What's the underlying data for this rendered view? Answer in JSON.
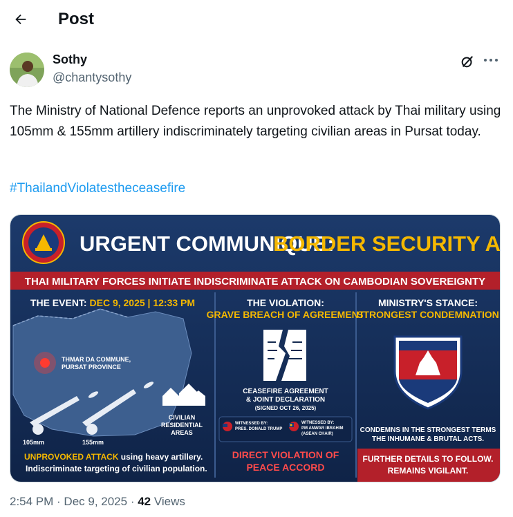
{
  "header": {
    "title": "Post"
  },
  "author": {
    "name": "Sothy",
    "handle": "@chantysothy"
  },
  "post": {
    "text": "The Ministry of National Defence reports an unprovoked attack by Thai military using 105mm & 155mm artillery indiscriminately targeting civilian areas in Pursat today.",
    "hashtag": "#ThailandViolatestheceasefire"
  },
  "media": {
    "headline_a": "URGENT COMMUNIQUE:",
    "headline_b": "BORDER SECURITY ALERT",
    "banner": "THAI MILITARY FORCES INITIATE INDISCRIMINATE ATTACK ON CAMBODIAN SOVEREIGNTY",
    "seal_text": "MINISTRY OF NATIONAL DEFENCE",
    "col1": {
      "heading_a": "THE EVENT:",
      "heading_b": "DEC 9, 2025 | 12:33 PM",
      "location_a": "THMAR DA COMMUNE,",
      "location_b": "PURSAT PROVINCE",
      "civ_a": "CIVILIAN",
      "civ_b": "RESIDENTIAL",
      "civ_c": "AREAS",
      "gun1": "105mm",
      "gun2": "155mm",
      "foot_a_red": "UNPROVOKED ATTACK",
      "foot_a_rest": "using heavy artillery.",
      "foot_b": "Indiscriminate targeting of civilian population."
    },
    "col2": {
      "heading_a": "THE VIOLATION:",
      "heading_b": "GRAVE BREACH OF AGREEMENT",
      "doc_a": "CEASEFIRE AGREEMENT",
      "doc_b": "& JOINT DECLARATION",
      "doc_c": "(SIGNED OCT 26, 2025)",
      "w1a": "WITNESSED BY:",
      "w1b": "PRES. DONALD TRUMP",
      "w2a": "WITNESSED BY:",
      "w2b": "PM ANWAR IBRAHIM",
      "w2c": "(ASEAN CHAIR)",
      "foot_a": "DIRECT VIOLATION OF",
      "foot_b": "PEACE ACCORD"
    },
    "col3": {
      "heading_a": "MINISTRY'S STANCE:",
      "heading_b": "STRONGEST CONDEMNATION",
      "cond_a": "CONDEMNS IN THE STRONGEST TERMS",
      "cond_b": "THE INHUMANE & BRUTAL ACTS.",
      "foot_a": "FURTHER DETAILS TO FOLLOW.",
      "foot_b": "REMAINS VIGILANT."
    }
  },
  "meta": {
    "time": "2:54 PM",
    "sep": " · ",
    "date": "Dec 9, 2025",
    "views_count": "42",
    "views_label": "Views"
  },
  "colors": {
    "navy": "#13294f",
    "gold": "#f5b800",
    "red": "#b3202a",
    "link": "#1d9bf0"
  }
}
